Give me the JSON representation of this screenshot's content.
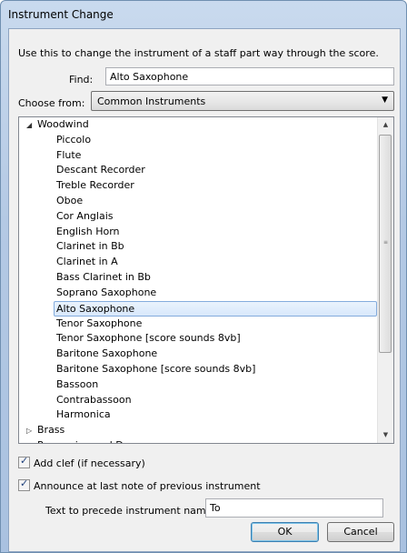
{
  "window": {
    "title": "Instrument Change"
  },
  "instruction": "Use this to change the instrument of a staff part way through the score.",
  "find": {
    "label": "Find:",
    "value": "Alto Saxophone"
  },
  "choose": {
    "label": "Choose from:",
    "value": "Common Instruments"
  },
  "tree": {
    "groups": [
      {
        "label": "Woodwind",
        "expanded": true,
        "expander": "◢"
      },
      {
        "label": "Brass",
        "expanded": false,
        "expander": "▷"
      },
      {
        "label": "Percussion and Drums",
        "expanded": false,
        "expander": "▷"
      }
    ],
    "woodwind_items": [
      "Piccolo",
      "Flute",
      "Descant Recorder",
      "Treble Recorder",
      "Oboe",
      "Cor Anglais",
      "English Horn",
      "Clarinet in Bb",
      "Clarinet in A",
      "Bass Clarinet in Bb",
      "Soprano Saxophone",
      "Alto Saxophone",
      "Tenor Saxophone",
      "Tenor Saxophone [score sounds 8vb]",
      "Baritone Saxophone",
      "Baritone Saxophone [score sounds 8vb]",
      "Bassoon",
      "Contrabassoon",
      "Harmonica"
    ],
    "selected": "Alto Saxophone"
  },
  "options": {
    "add_clef": {
      "label": "Add clef (if necessary)",
      "checked": true
    },
    "announce": {
      "label": "Announce at last note of previous instrument",
      "checked": true
    }
  },
  "precede": {
    "label": "Text to precede instrument name:",
    "value": "To"
  },
  "buttons": {
    "ok": "OK",
    "cancel": "Cancel"
  },
  "colors": {
    "selection_border": "#84acdd",
    "title_bar": "#b4c9e4"
  }
}
